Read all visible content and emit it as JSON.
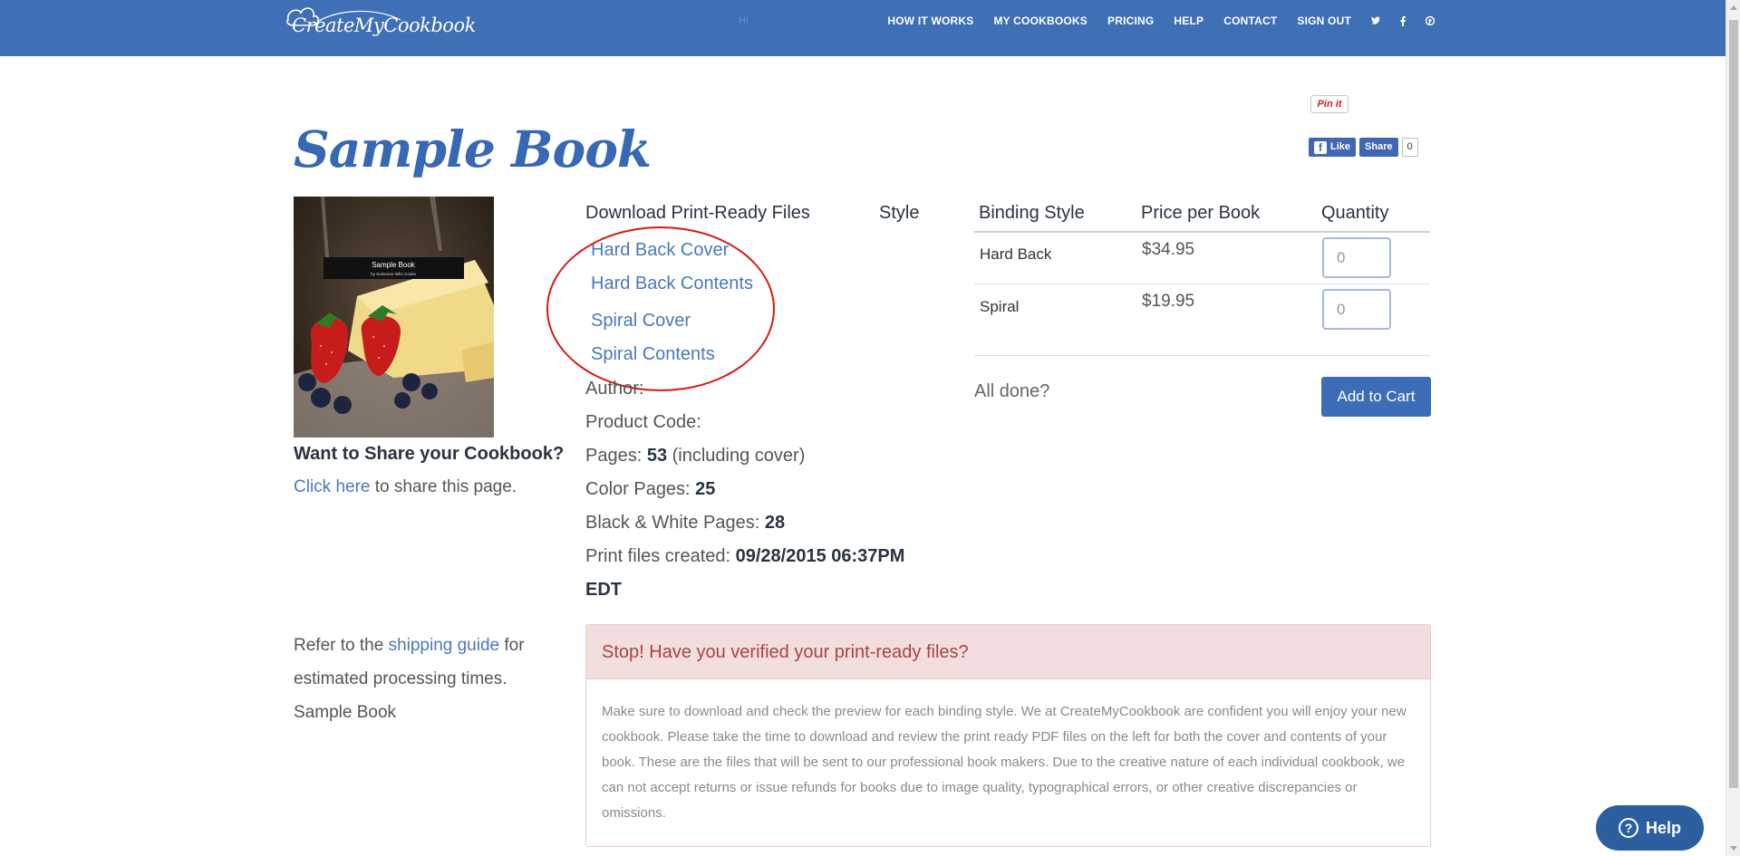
{
  "header": {
    "logo_text": "CreateMyCookbook",
    "faint_text": "Hi",
    "nav": [
      "HOW IT WORKS",
      "MY COOKBOOKS",
      "PRICING",
      "HELP",
      "CONTACT",
      "SIGN OUT"
    ],
    "social_icons": [
      "twitter-icon",
      "facebook-icon",
      "pinterest-icon"
    ],
    "accent": "#3f6fb5"
  },
  "page": {
    "title": "Sample Book"
  },
  "social": {
    "pin_label": "Pin it",
    "like_label": "Like",
    "share_label": "Share",
    "share_count": "0"
  },
  "cover": {
    "title": "Sample Book",
    "subtitle": "by Someone Who Cooks"
  },
  "share": {
    "heading": "Want to Share your Cookbook?",
    "link_text": "Click here",
    "after_text": " to share this page."
  },
  "shipping": {
    "before": "Refer to the ",
    "link": "shipping guide",
    "after": " for estimated processing times.",
    "book_name": "Sample Book"
  },
  "downloads": {
    "heading": "Download Print-Ready Files",
    "style_heading": "Style",
    "links": [
      "Hard Back Cover",
      "Hard Back Contents",
      "Spiral Cover",
      "Spiral Contents"
    ]
  },
  "meta": {
    "author_label": "Author:",
    "product_code_label": "Product Code:",
    "pages_label": "Pages: ",
    "pages_value": "53",
    "pages_suffix": " (including cover)",
    "color_label": "Color Pages: ",
    "color_value": "25",
    "bw_label": "Black & White Pages: ",
    "bw_value": "28",
    "created_label": "Print files created: ",
    "created_value": "09/28/2015 06:37PM",
    "created_tz": "EDT"
  },
  "binding": {
    "headers": [
      "Binding Style",
      "Price per Book",
      "Quantity"
    ],
    "rows": [
      {
        "style": "Hard Back",
        "price": "$34.95",
        "quantity": "0"
      },
      {
        "style": "Spiral",
        "price": "$19.95",
        "quantity": "0"
      }
    ],
    "done_label": "All done?",
    "add_to_cart": "Add to Cart"
  },
  "alert": {
    "title": "Stop! Have you verified your print-ready files?",
    "body": "Make sure to download and check the preview for each binding style. We at CreateMyCookbook are confident you will enjoy your new cookbook. Please take the time to download and review the print ready PDF files on the left for both the cover and contents of your book. These are the files that will be sent to our professional book makers. Due to the creative nature of each individual cookbook, we can not accept returns or issue refunds for books due to image quality, typographical errors, or other creative discrepancies or omissions."
  },
  "help_widget": {
    "label": "Help"
  }
}
